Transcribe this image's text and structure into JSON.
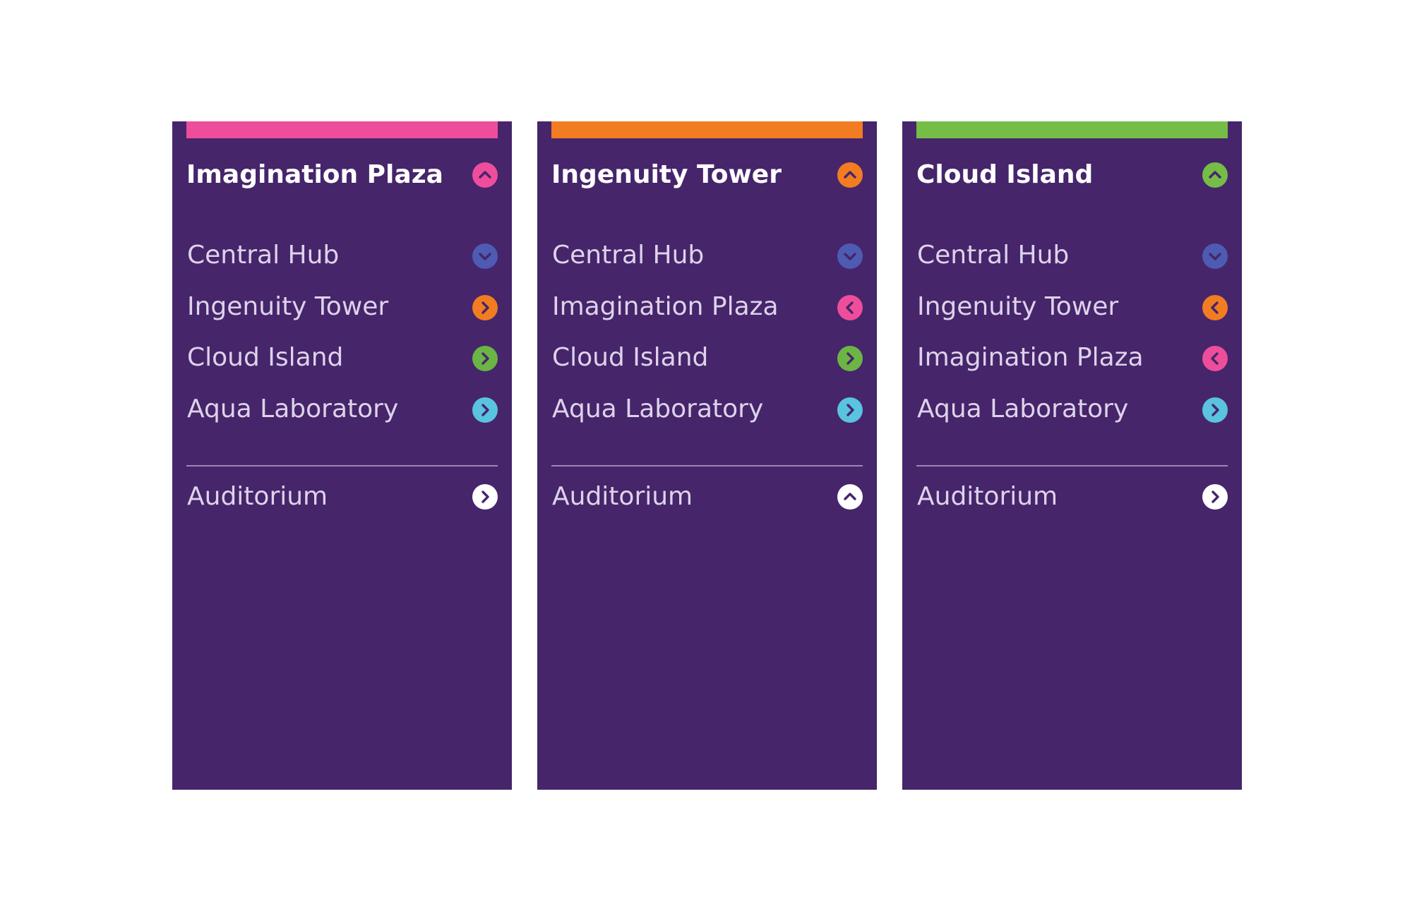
{
  "signs": [
    {
      "title": "Imagination Plaza",
      "accent_color": "#ee4d9b",
      "header_icon": "chevron-up-icon",
      "destinations": [
        {
          "label": "Central Hub",
          "icon": "chevron-down-icon",
          "color": "#4d5bb3"
        },
        {
          "label": "Ingenuity Tower",
          "icon": "chevron-right-icon",
          "color": "#f27c21"
        },
        {
          "label": "Cloud Island",
          "icon": "chevron-right-icon",
          "color": "#6bb545"
        },
        {
          "label": "Aqua Laboratory",
          "icon": "chevron-right-icon",
          "color": "#5ac3df"
        }
      ],
      "auditorium": {
        "label": "Auditorium",
        "icon": "chevron-right-icon",
        "color": "#ffffff"
      }
    },
    {
      "title": "Ingenuity Tower",
      "accent_color": "#f27c21",
      "header_icon": "chevron-up-icon",
      "destinations": [
        {
          "label": "Central Hub",
          "icon": "chevron-down-icon",
          "color": "#4d5bb3"
        },
        {
          "label": "Imagination Plaza",
          "icon": "chevron-left-icon",
          "color": "#ee4d9b"
        },
        {
          "label": "Cloud Island",
          "icon": "chevron-right-icon",
          "color": "#6bb545"
        },
        {
          "label": "Aqua Laboratory",
          "icon": "chevron-right-icon",
          "color": "#5ac3df"
        }
      ],
      "auditorium": {
        "label": "Auditorium",
        "icon": "chevron-up-icon",
        "color": "#ffffff"
      }
    },
    {
      "title": "Cloud Island",
      "accent_color": "#76bd48",
      "header_icon": "chevron-up-icon",
      "destinations": [
        {
          "label": "Central Hub",
          "icon": "chevron-down-icon",
          "color": "#4d5bb3"
        },
        {
          "label": "Ingenuity Tower",
          "icon": "chevron-left-icon",
          "color": "#f27c21"
        },
        {
          "label": "Imagination Plaza",
          "icon": "chevron-left-icon",
          "color": "#ee4d9b"
        },
        {
          "label": "Aqua Laboratory",
          "icon": "chevron-right-icon",
          "color": "#5ac3df"
        }
      ],
      "auditorium": {
        "label": "Auditorium",
        "icon": "chevron-right-icon",
        "color": "#ffffff"
      }
    }
  ],
  "colors": {
    "panel_background": "#46256b",
    "label_text": "#ddd3ea",
    "title_text": "#ffffff",
    "divider": "#9d86b7"
  }
}
